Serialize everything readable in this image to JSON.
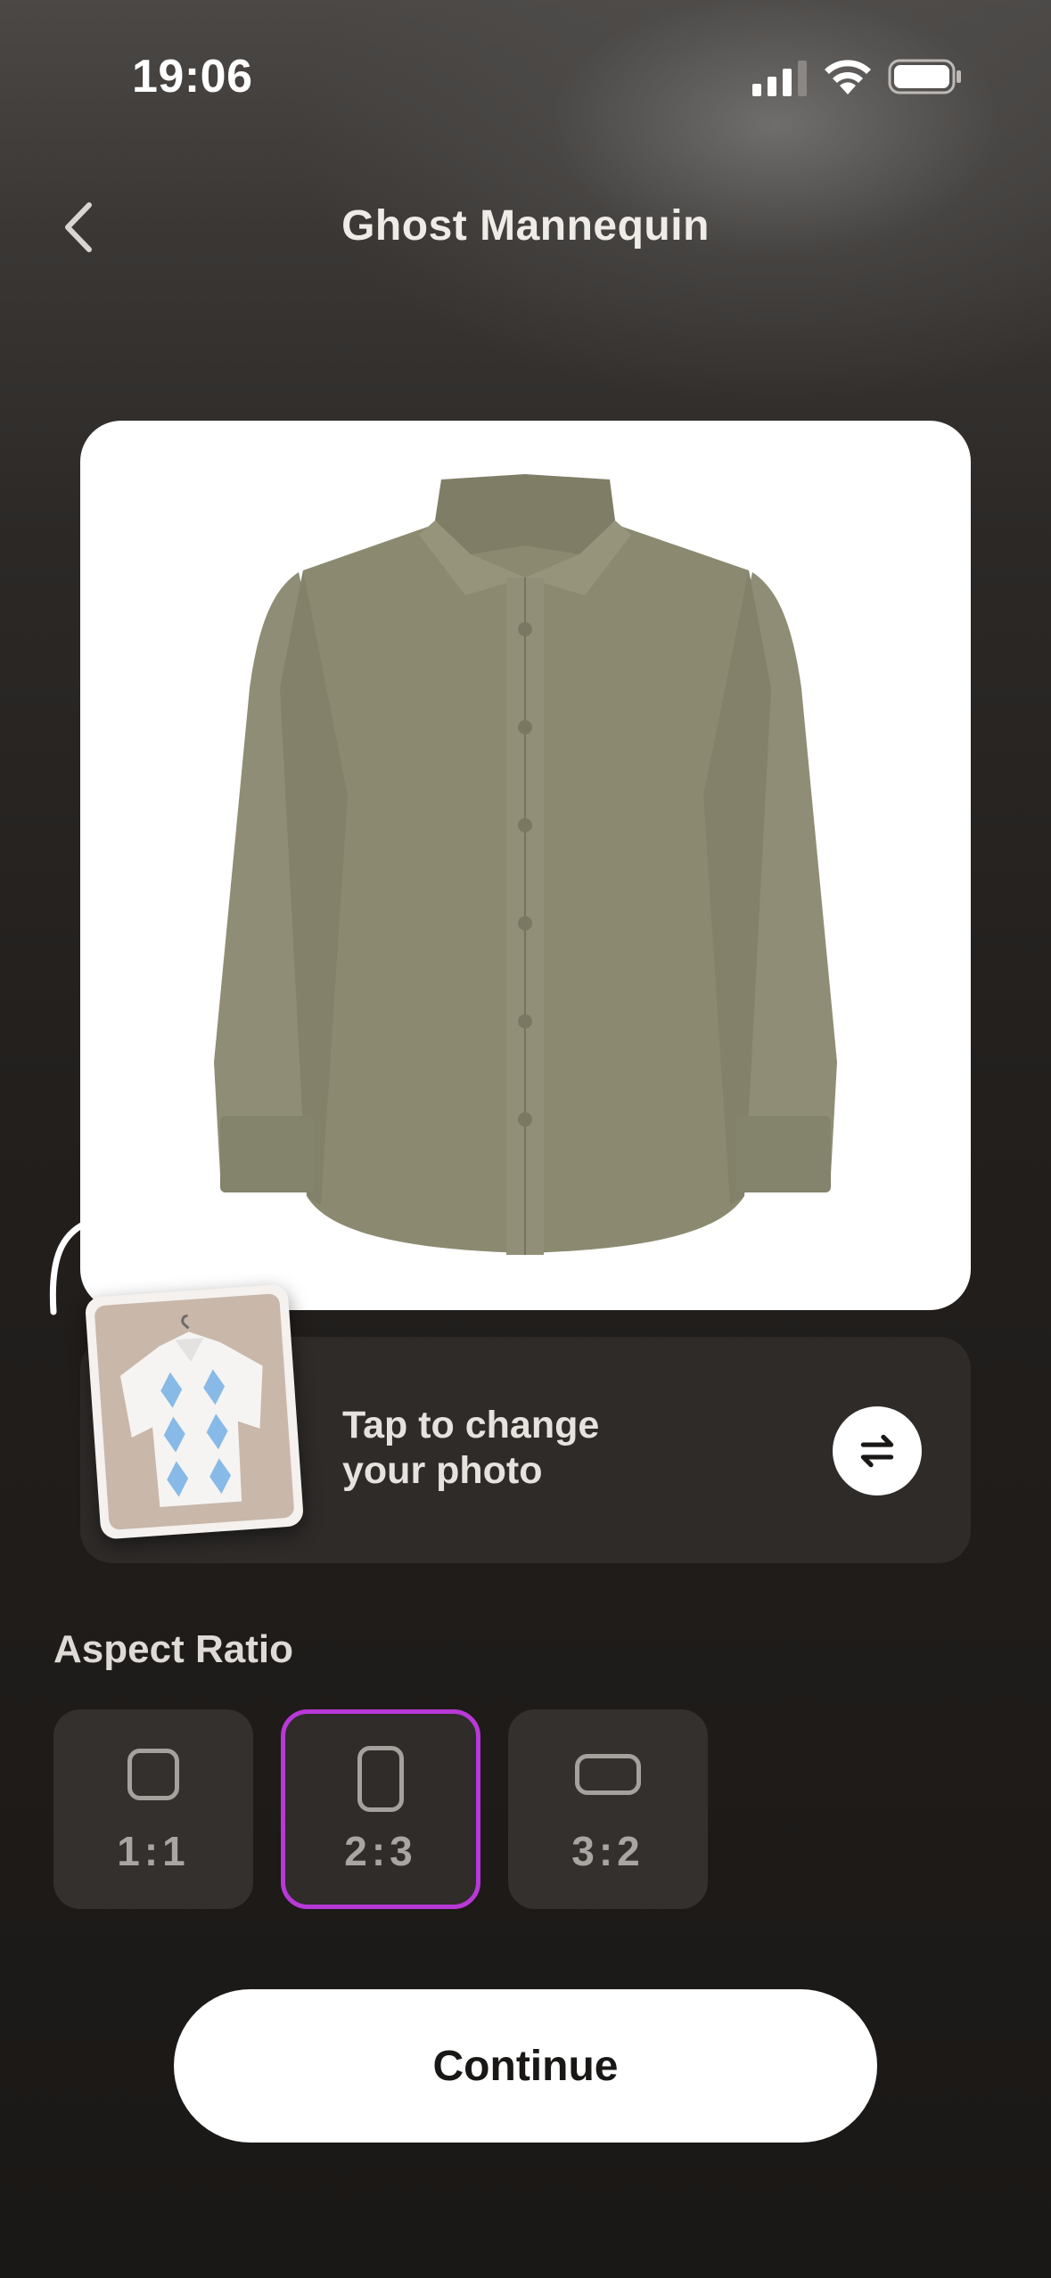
{
  "status_bar": {
    "time": "19:06"
  },
  "header": {
    "title": "Ghost Mannequin",
    "back_icon": "chevron-left-icon"
  },
  "preview": {
    "image": "olive-green-button-down-shirt"
  },
  "change_photo": {
    "label_line1": "Tap to change",
    "label_line2": "your photo",
    "thumbnail": "white-argyle-polo-shirt-on-hanger",
    "swap_icon": "swap-arrows-icon"
  },
  "aspect_ratio": {
    "label": "Aspect Ratio",
    "options": [
      {
        "label": "1:1",
        "selected": false,
        "icon": "square-icon"
      },
      {
        "label": "2:3",
        "selected": true,
        "icon": "portrait-rect-icon"
      },
      {
        "label": "3:2",
        "selected": false,
        "icon": "landscape-rect-icon"
      }
    ],
    "selected_color": "#b839d6"
  },
  "continue_button": {
    "label": "Continue"
  }
}
